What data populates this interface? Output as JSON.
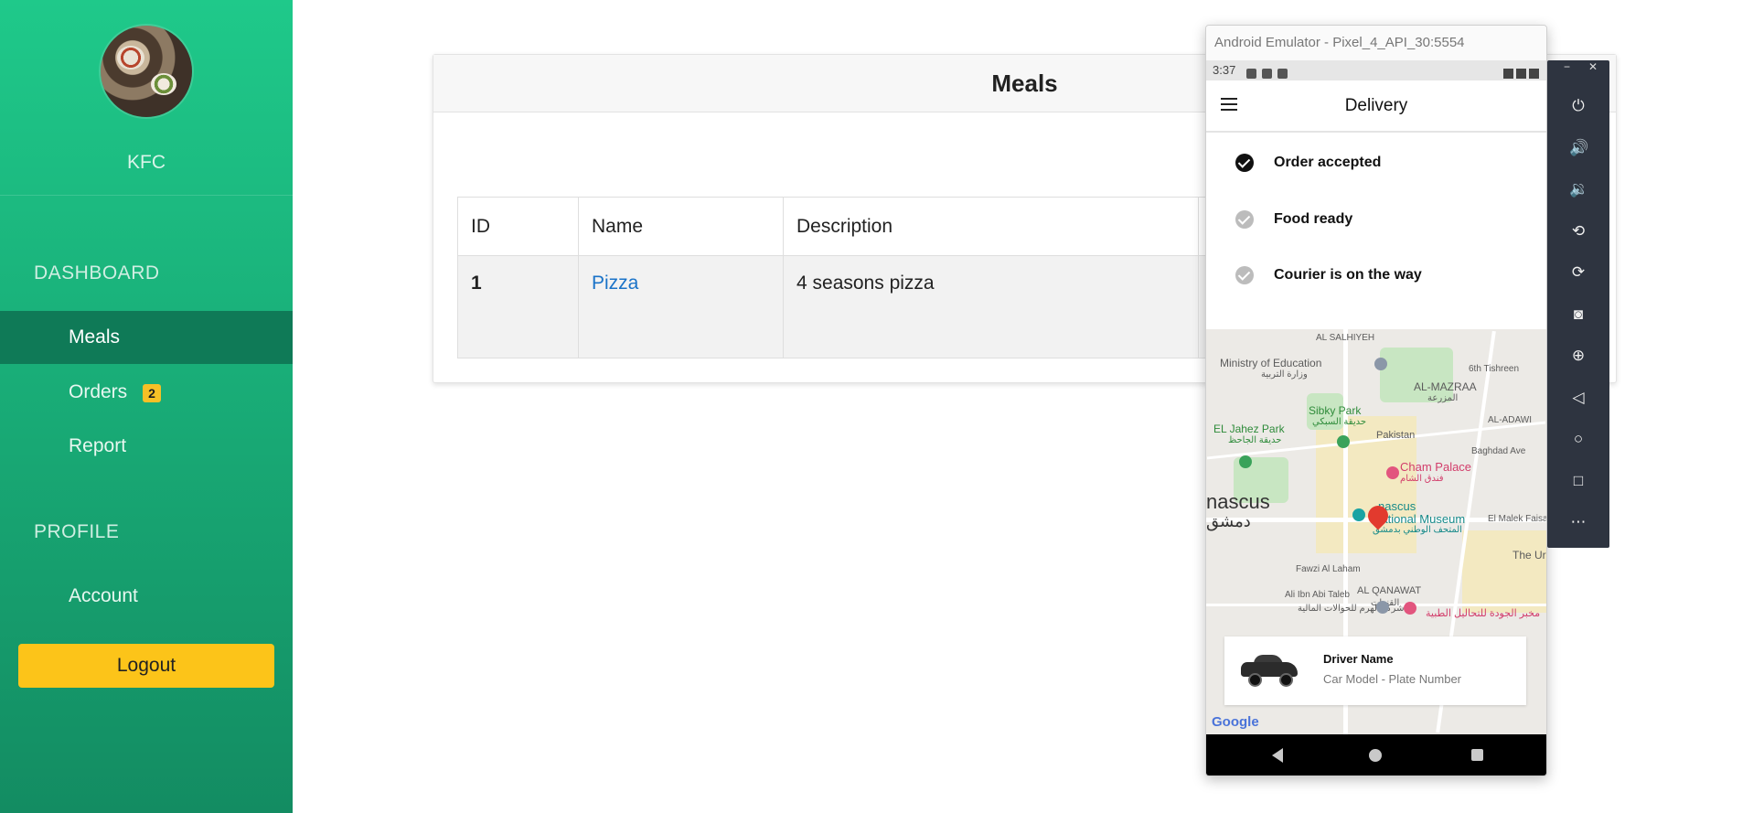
{
  "sidebar": {
    "brand": "KFC",
    "section_dashboard": "DASHBOARD",
    "items": [
      {
        "label": "Meals"
      },
      {
        "label": "Orders",
        "badge": "2"
      },
      {
        "label": "Report"
      }
    ],
    "section_profile": "PROFILE",
    "account_label": "Account",
    "logout_label": "Logout"
  },
  "card": {
    "title": "Meals",
    "columns": [
      "ID",
      "Name",
      "Description"
    ],
    "rows": [
      {
        "id": "1",
        "name": "Pizza",
        "description": "4 seasons pizza"
      }
    ]
  },
  "emulator": {
    "window_title": "Android Emulator - Pixel_4_API_30:5554",
    "status_time": "3:37",
    "app_title": "Delivery",
    "steps": [
      {
        "label": "Order accepted",
        "done": true
      },
      {
        "label": "Food ready",
        "done": false
      },
      {
        "label": "Courier is on the way",
        "done": false
      }
    ],
    "map_labels": {
      "salhiyeh": "AL SALHIYEH",
      "ministry": "Ministry of Education",
      "ministry_ar": "وزارة التربية",
      "mazraa": "AL-MAZRAA",
      "mazraa_ar": "المزرعة",
      "sixth_tishreen": "6th Tishreen",
      "sibky": "Sibky Park",
      "sibky_ar": "حديقة السبكي",
      "jahez": "EL Jahez Park",
      "jahez_ar": "حديقة الجاحظ",
      "pakistan": "Pakistan",
      "adawi": "AL-ADAWI",
      "baghdad": "Baghdad Ave",
      "cham": "Cham Palace",
      "cham_ar": "فندق الشام",
      "damascus": "nascus",
      "damascus_ar": "دمشق",
      "museum_1": "nascus",
      "museum_2": "National Museum",
      "museum_ar": "المتحف الوطني بدمشق",
      "malek": "El Malek Faisal",
      "the_ur": "The Ur",
      "fawzi": "Fawzi Al Laham",
      "ali": "Ali Ibn Abi Taleb",
      "qanawat": "AL QANAWAT",
      "qanawat_ar": "القنوات",
      "haram_ar": "شركة الهرم للحوالات المالية",
      "jawda_ar": "مخبر الجودة للتحاليل الطبية",
      "google": "Google"
    },
    "driver": {
      "name": "Driver Name",
      "subtitle": "Car Model - Plate Number"
    }
  }
}
